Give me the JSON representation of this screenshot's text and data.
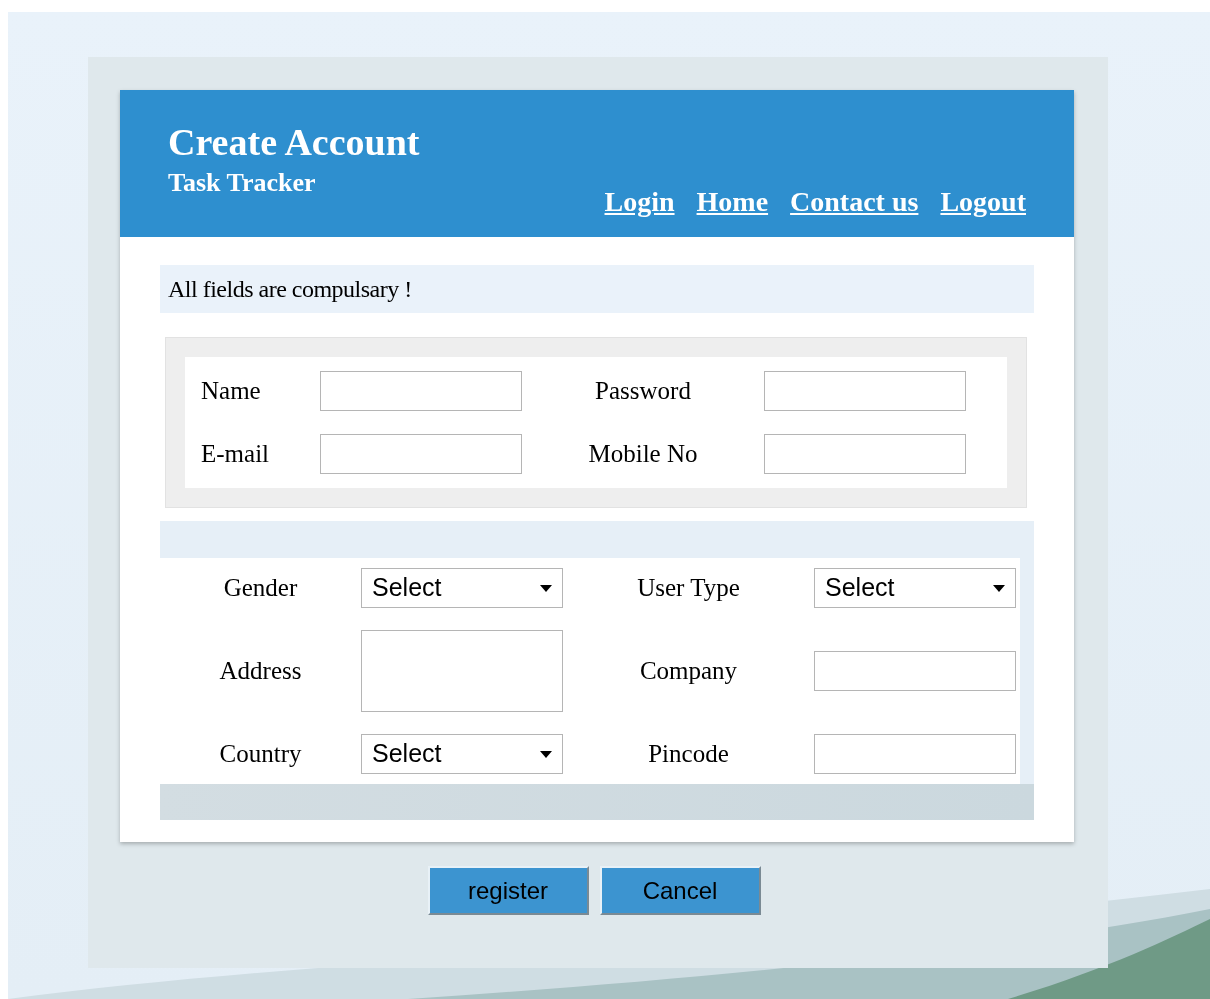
{
  "header": {
    "title": "Create Account",
    "subtitle": "Task Tracker",
    "nav_links": [
      "Login",
      "Home",
      "Contact us",
      "Logout"
    ]
  },
  "notice": "All fields are compulsary !",
  "account_fields": [
    {
      "label": "Name"
    },
    {
      "label": "Password"
    },
    {
      "label": "E-mail"
    },
    {
      "label": "Mobile No"
    }
  ],
  "profile_fields": [
    {
      "label": "Gender",
      "kind": "select",
      "value": "Select"
    },
    {
      "label": "User Type",
      "kind": "select",
      "value": "Select"
    },
    {
      "label": "Address",
      "kind": "textarea"
    },
    {
      "label": "Company",
      "kind": "text"
    },
    {
      "label": "Country",
      "kind": "select",
      "value": "Select"
    },
    {
      "label": "Pincode",
      "kind": "text"
    }
  ],
  "buttons": [
    "register",
    "Cancel"
  ]
}
